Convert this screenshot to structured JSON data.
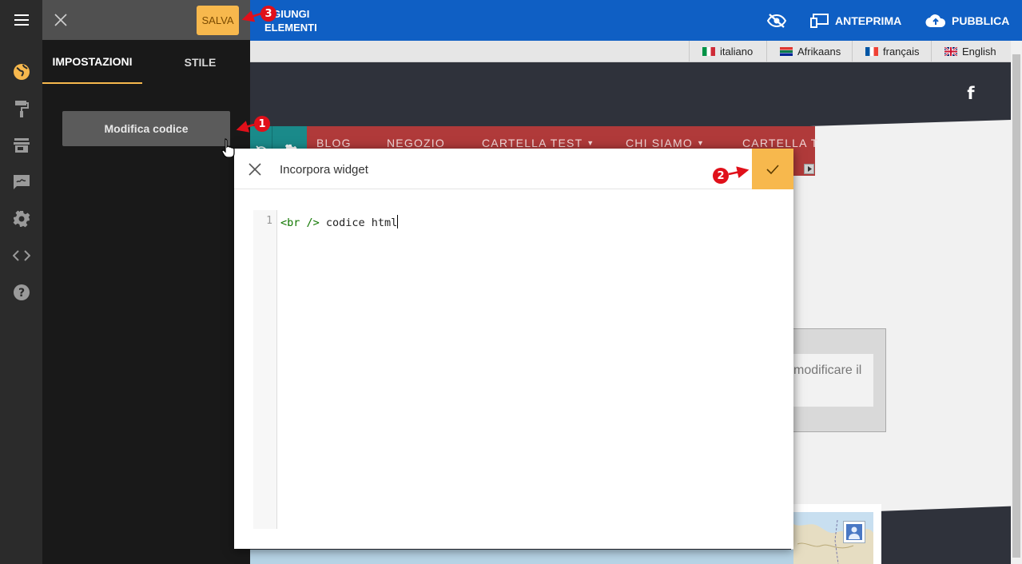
{
  "panel": {
    "save_label": "SALVA",
    "tabs": [
      {
        "label": "IMPOSTAZIONI",
        "active": true
      },
      {
        "label": "STILE",
        "active": false
      }
    ],
    "edit_code_label": "Modifica codice"
  },
  "rail": {
    "icons": [
      "globe-icon",
      "paint-roller-icon",
      "store-icon",
      "signature-icon",
      "gear-icon",
      "code-icon",
      "help-icon"
    ],
    "accent": "#f7b84d"
  },
  "topbar": {
    "add_elements_label": "GGIUNGI\nELEMENTI",
    "preview_label": "ANTEPRIMA",
    "publish_label": "PUBBLICA",
    "color": "#0f5fc4"
  },
  "languages": [
    {
      "label": "italiano",
      "flag": "it"
    },
    {
      "label": "Afrikaans",
      "flag": "za"
    },
    {
      "label": "français",
      "flag": "fr"
    },
    {
      "label": "English",
      "flag": "gb"
    }
  ],
  "site": {
    "nav_items": [
      "BLOG",
      "NEGOZIO",
      "CARTELLA TEST",
      "CHI SIAMO",
      "CARTELLA T"
    ],
    "nav_dropdowns": [
      false,
      false,
      true,
      true,
      false
    ],
    "facebook_glyph": "f",
    "card_text": "modificare il"
  },
  "modal": {
    "title": "Incorpora widget",
    "line_number": "1",
    "code_tag": "<br />",
    "code_text": " codice html"
  },
  "markers": [
    "1",
    "2",
    "3"
  ],
  "colors": {
    "save_bg": "#f7b84d",
    "nav_bg": "#b03a3a",
    "nav_teal": "#1a8a8a",
    "marker_red": "#e0101a"
  }
}
